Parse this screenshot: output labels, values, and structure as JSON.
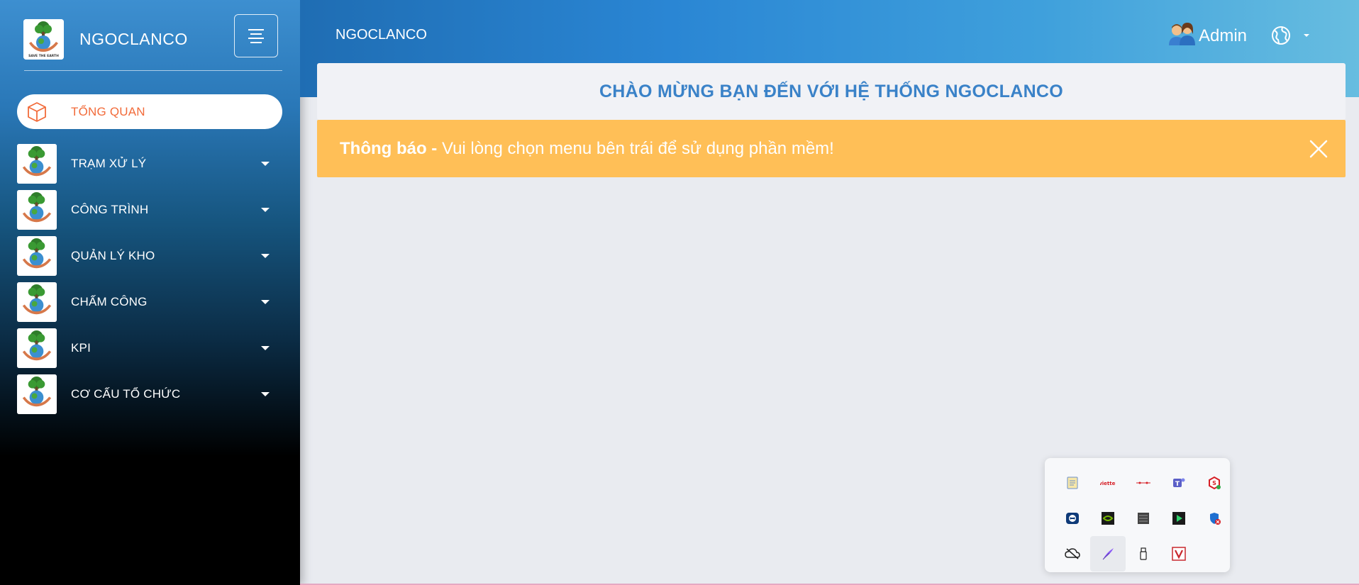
{
  "brand": {
    "title": "NGOCLANCO"
  },
  "sidebar": {
    "items": [
      {
        "label": "TỔNG QUAN",
        "active": true
      },
      {
        "label": "TRẠM XỬ LÝ"
      },
      {
        "label": "CÔNG TRÌNH"
      },
      {
        "label": "QUẢN LÝ KHO"
      },
      {
        "label": "CHẤM CÔNG"
      },
      {
        "label": "KPI"
      },
      {
        "label": "CƠ CẤU TỔ CHỨC"
      }
    ]
  },
  "header": {
    "title": "NGOCLANCO",
    "user_label": "Admin"
  },
  "main": {
    "welcome": "CHÀO MỪNG BẠN ĐẾN VỚI HỆ THỐNG NGOCLANCO",
    "alert_title": "Thông báo -",
    "alert_message": " Vui lòng chọn menu bên trái để sử dụng phần mềm!"
  },
  "tray": {
    "icons": [
      "notepad-icon",
      "viettel-icon",
      "network-icon",
      "teams-icon",
      "security-shield-icon",
      "teamviewer-icon",
      "nvidia-icon",
      "server-icon",
      "media-player-icon",
      "defender-icon",
      "cloud-offline-icon",
      "feather-pen-icon",
      "usb-drive-icon",
      "v-app-icon"
    ]
  },
  "colors": {
    "accent": "#3a82c8",
    "active_item": "#f26b3a",
    "alert_bg": "#ffbf57"
  }
}
